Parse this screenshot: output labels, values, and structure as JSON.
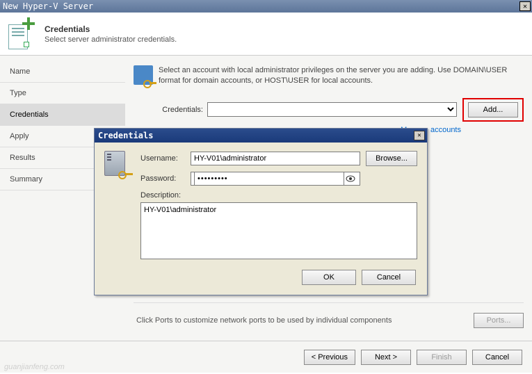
{
  "window": {
    "title": "New Hyper-V Server"
  },
  "header": {
    "title": "Credentials",
    "subtitle": "Select server administrator credentials."
  },
  "sidebar": {
    "items": [
      {
        "label": "Name"
      },
      {
        "label": "Type"
      },
      {
        "label": "Credentials"
      },
      {
        "label": "Apply"
      },
      {
        "label": "Results"
      },
      {
        "label": "Summary"
      }
    ],
    "activeIndex": 2
  },
  "main": {
    "info": "Select an account with local administrator privileges on the server you are adding. Use DOMAIN\\USER format for domain accounts, or HOST\\USER for local accounts.",
    "credLabel": "Credentials:",
    "credValue": "",
    "addBtn": "Add...",
    "manageLink": "Manage accounts",
    "portsText": "Click Ports to customize network ports to be used by individual components",
    "portsBtn": "Ports..."
  },
  "modal": {
    "title": "Credentials",
    "usernameLabel": "Username:",
    "usernameValue": "HY-V01\\administrator",
    "browseBtn": "Browse...",
    "passwordLabel": "Password:",
    "passwordValue": "•••••••••",
    "descLabel": "Description:",
    "descValue": "HY-V01\\administrator",
    "okBtn": "OK",
    "cancelBtn": "Cancel"
  },
  "footer": {
    "prev": "< Previous",
    "next": "Next >",
    "finish": "Finish",
    "cancel": "Cancel"
  },
  "watermark": "guanjianfeng.com"
}
